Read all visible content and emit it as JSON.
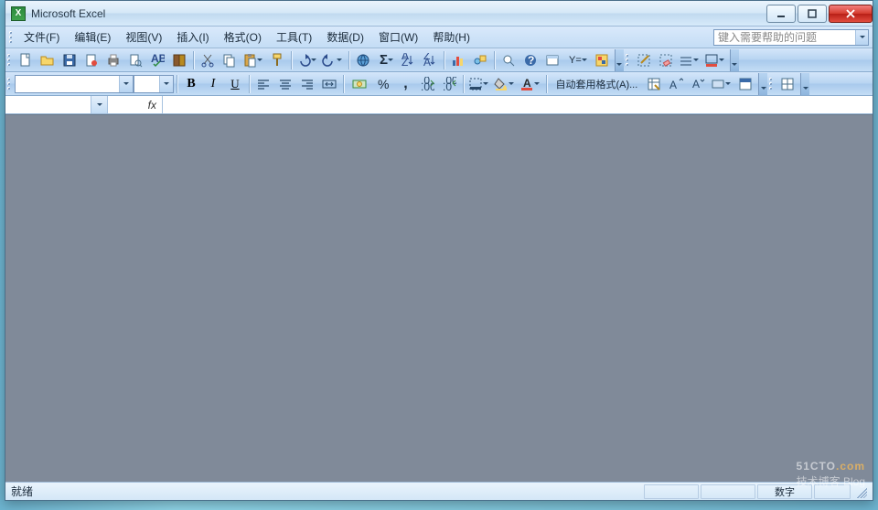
{
  "window": {
    "title": "Microsoft Excel"
  },
  "menu": {
    "items": [
      {
        "label": "文件(F)",
        "key": "F"
      },
      {
        "label": "编辑(E)",
        "key": "E"
      },
      {
        "label": "视图(V)",
        "key": "V"
      },
      {
        "label": "插入(I)",
        "key": "I"
      },
      {
        "label": "格式(O)",
        "key": "O"
      },
      {
        "label": "工具(T)",
        "key": "T"
      },
      {
        "label": "数据(D)",
        "key": "D"
      },
      {
        "label": "窗口(W)",
        "key": "W"
      },
      {
        "label": "帮助(H)",
        "key": "H"
      }
    ],
    "help_placeholder": "键入需要帮助的问题"
  },
  "toolbar_standard_icons": [
    "new-doc-icon",
    "open-folder-icon",
    "save-icon",
    "permission-icon",
    "print-icon",
    "print-preview-icon",
    "spellcheck-icon",
    "research-icon",
    "sep",
    "cut-icon",
    "copy-icon",
    "paste-icon",
    "format-painter-icon",
    "sep",
    "undo-icon",
    "redo-icon",
    "sep",
    "hyperlink-icon",
    "autosum-icon",
    "sort-asc-icon",
    "sort-desc-icon",
    "sep",
    "chart-wizard-icon",
    "drawing-icon",
    "sep",
    "zoom-icon",
    "help-icon",
    "show-formula-icon",
    "autofilter-icon",
    "highlight-icon"
  ],
  "toolbar_border_icons": [
    "border-clear-icon",
    "border-outer-icon",
    "border-inner-icon",
    "border-all-icon",
    "border-custom-icon"
  ],
  "formatting": {
    "font_name": "",
    "font_size": "",
    "bold": "B",
    "italic": "I",
    "underline": "U",
    "percent": "%",
    "comma": ",",
    "autoformat_label": "自动套用格式(A)...",
    "currency_symbol": "￥"
  },
  "formula_bar": {
    "name_box_value": "",
    "fx_label": "fx",
    "formula_value": ""
  },
  "status": {
    "ready": "就绪",
    "numlock": "数字"
  },
  "watermark": {
    "line1_a": "51CTO",
    "line1_b": ".com",
    "line2": "技术博客  Blog"
  }
}
